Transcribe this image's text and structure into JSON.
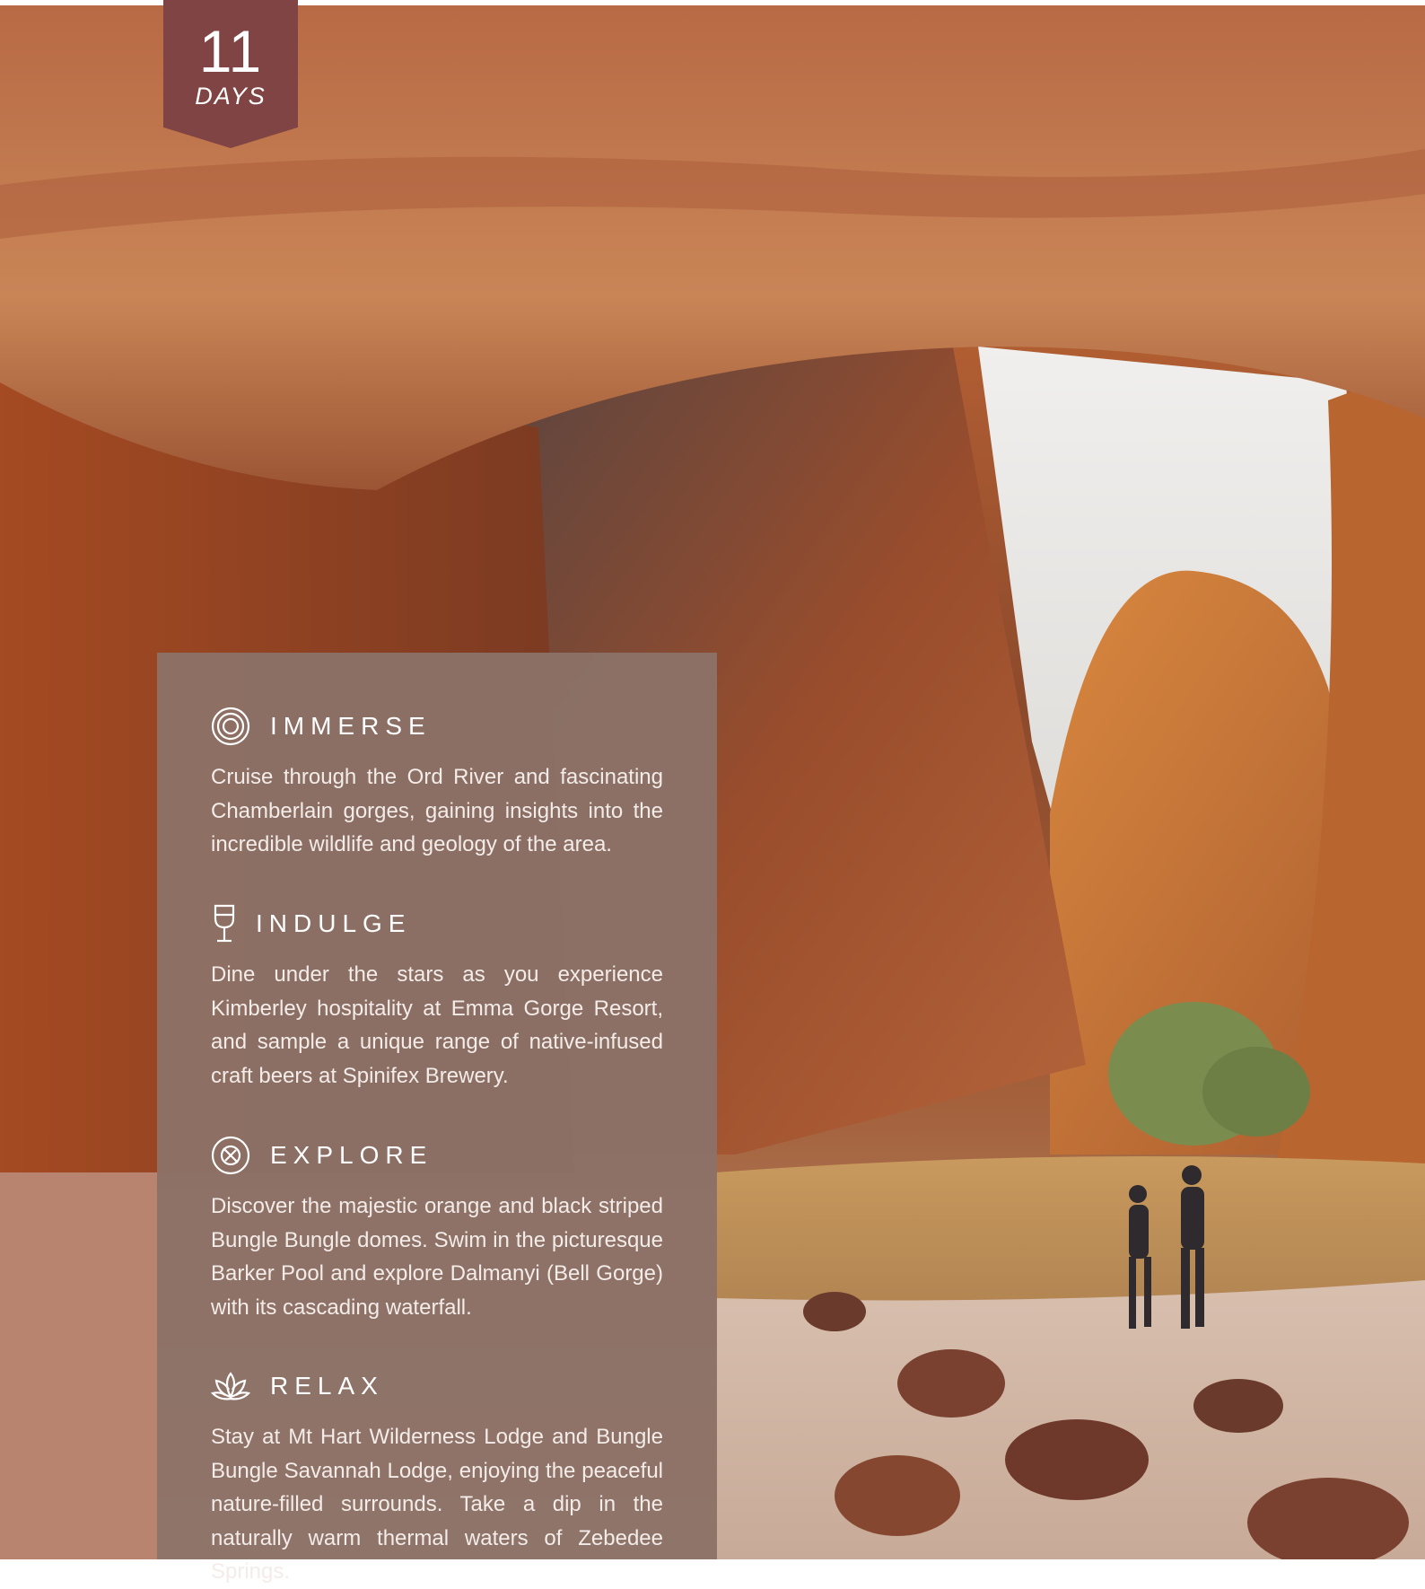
{
  "badge": {
    "number": "11",
    "unit": "DAYS"
  },
  "colors": {
    "badge": "#7f4443",
    "panel": "#8c7268",
    "text": "#ffffff"
  },
  "sections": [
    {
      "icon": "concentric-circles-icon",
      "title": "IMMERSE",
      "body": "Cruise through the Ord River and fascinating Chamberlain gorges, gaining insights into the incredible wildlife and geology of the area."
    },
    {
      "icon": "wine-glass-icon",
      "title": "INDULGE",
      "body": "Dine under the stars as you experience Kimberley hospitality at Emma Gorge Resort, and sample a unique range of native-infused craft beers at Spinifex Brewery."
    },
    {
      "icon": "compass-icon",
      "title": "EXPLORE",
      "body": "Discover the majestic orange and black striped Bungle Bungle domes. Swim in the picturesque Barker Pool and explore Dalmanyi (Bell Gorge) with its cascading waterfall."
    },
    {
      "icon": "lotus-icon",
      "title": "RELAX",
      "body": "Stay at Mt Hart Wilderness Lodge and Bungle Bungle Savannah Lodge, enjoying the peaceful nature-filled surrounds. Take a dip in the naturally warm thermal waters of Zebedee Springs."
    }
  ]
}
